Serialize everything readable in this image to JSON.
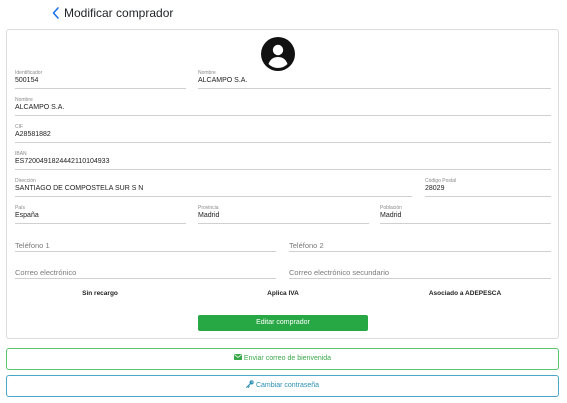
{
  "header": {
    "back_icon": "chevron-left-icon",
    "title": "Modificar comprador"
  },
  "avatar": {
    "icon": "user-circle-icon"
  },
  "form": {
    "identificador": {
      "label": "Identificador",
      "value": "500154"
    },
    "nombre_top": {
      "label": "Nombre",
      "value": "ALCAMPO S.A."
    },
    "nombre": {
      "label": "Nombre",
      "value": "ALCAMPO S.A."
    },
    "cif": {
      "label": "CIF",
      "value": "A28581882"
    },
    "iban": {
      "label": "IBAN",
      "value": "ES7200491824442110104933"
    },
    "direccion": {
      "label": "Dirección",
      "value": "SANTIAGO DE COMPOSTELA SUR S N"
    },
    "codigo_postal": {
      "label": "Código Postal",
      "value": "28029"
    },
    "pais": {
      "label": "País",
      "value": "España"
    },
    "provincia": {
      "label": "Provincia",
      "value": "Madrid"
    },
    "poblacion": {
      "label": "Población",
      "value": "Madrid"
    },
    "telefono1": {
      "placeholder": "Teléfono 1"
    },
    "telefono2": {
      "placeholder": "Teléfono 2"
    },
    "correo": {
      "placeholder": "Correo electrónico"
    },
    "correo_secundario": {
      "placeholder": "Correo electrónico secundario"
    }
  },
  "flags": {
    "sin_recargo": "Sin recargo",
    "aplica_iva": "Aplica IVA",
    "asociado": "Asociado a ADEPESCA"
  },
  "actions": {
    "edit_label": "Editar comprador",
    "welcome_label": "Enviar correo de bienvenida",
    "welcome_icon": "envelope-icon",
    "password_label": "Cambiar contraseña",
    "password_icon": "key-icon"
  },
  "colors": {
    "primary_green": "#28a745",
    "outline_green": "#39a84a",
    "outline_blue": "#2a8fb4",
    "back_blue": "#1a73e8"
  }
}
